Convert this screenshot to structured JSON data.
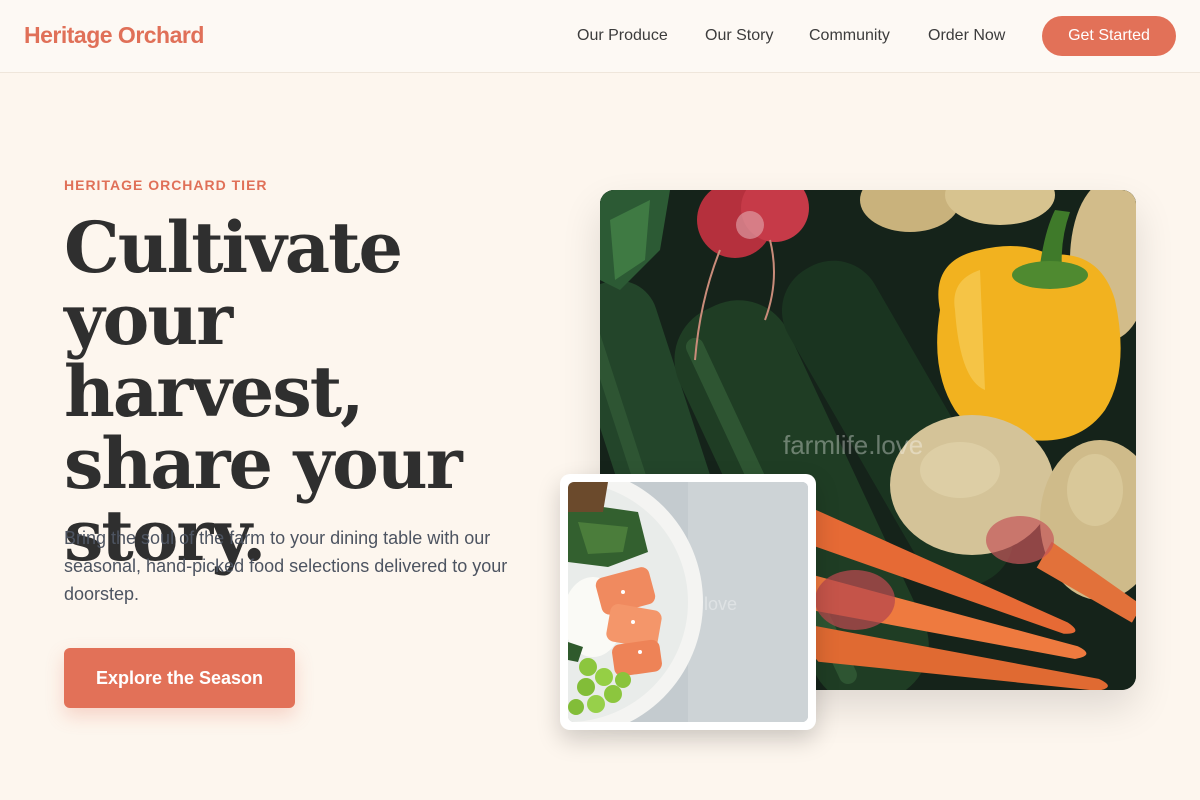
{
  "header": {
    "brand": "Heritage Orchard",
    "nav": [
      "Our Produce",
      "Our Story",
      "Community",
      "Order Now"
    ],
    "cta": "Get Started"
  },
  "hero": {
    "eyebrow": "HERITAGE ORCHARD TIER",
    "headline": [
      "Cultivate your",
      "harvest,",
      "share your",
      "story."
    ],
    "body": "Bring the soul of the farm to your dining table with our seasonal, hand-picked food selections delivered to your doorstep.",
    "button": "Explore the Season"
  },
  "images": {
    "main_watermark": "farmlife.love",
    "inset_watermark": "love"
  },
  "colors": {
    "accent": "#e27158",
    "background": "#fdf6ee",
    "text": "#2f2f2f"
  }
}
